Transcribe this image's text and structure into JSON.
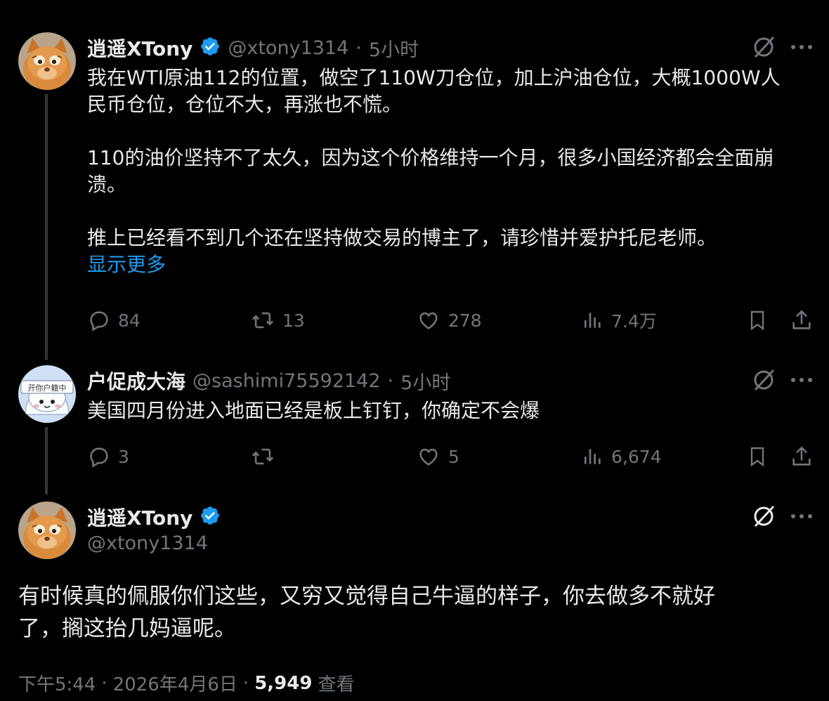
{
  "colors": {
    "background": "#000000",
    "text": "#e7e9ea",
    "muted": "#71767b",
    "accent": "#1d9bf0"
  },
  "tweet1": {
    "name": "逍遥XTony",
    "handle": "@xtony1314",
    "dot": "·",
    "time": "5小时",
    "verified_icon": "verified-badge-icon",
    "lines": [
      "我在WTI原油112的位置，做空了110W刀仓位，加上沪油仓位，大概1000W人",
      "民币仓位，仓位不大，再涨也不慌。",
      "110的油价坚持不了太久，因为这个价格维持一个月，很多小国经济都会全面崩",
      "溃。",
      "推上已经看不到几个还在坚持做交易的博主了，请珍惜并爱护托尼老师。"
    ],
    "show_more": "显示更多",
    "replies": "84",
    "reposts": "13",
    "likes": "278",
    "views": "7.4万"
  },
  "tweet2": {
    "name": "户促成大海",
    "handle": "@sashimi75592142",
    "dot": "·",
    "time": "5小时",
    "avatar_text": "开你户籍中",
    "text": "美国四月份进入地面已经是板上钉钉，你确定不会爆",
    "replies": "3",
    "reposts": "",
    "likes": "5",
    "views": "6,674"
  },
  "tweet3": {
    "name": "逍遥XTony",
    "handle": "@xtony1314",
    "lines": [
      "有时候真的佩服你们这些，又穷又觉得自己牛逼的样子，你去做多不就好",
      "了，搁这抬几妈逼呢。"
    ],
    "time_label": "下午5:44",
    "dot": "·",
    "date": "2026年4月6日",
    "views_count": "5,949",
    "views_label": "查看"
  }
}
